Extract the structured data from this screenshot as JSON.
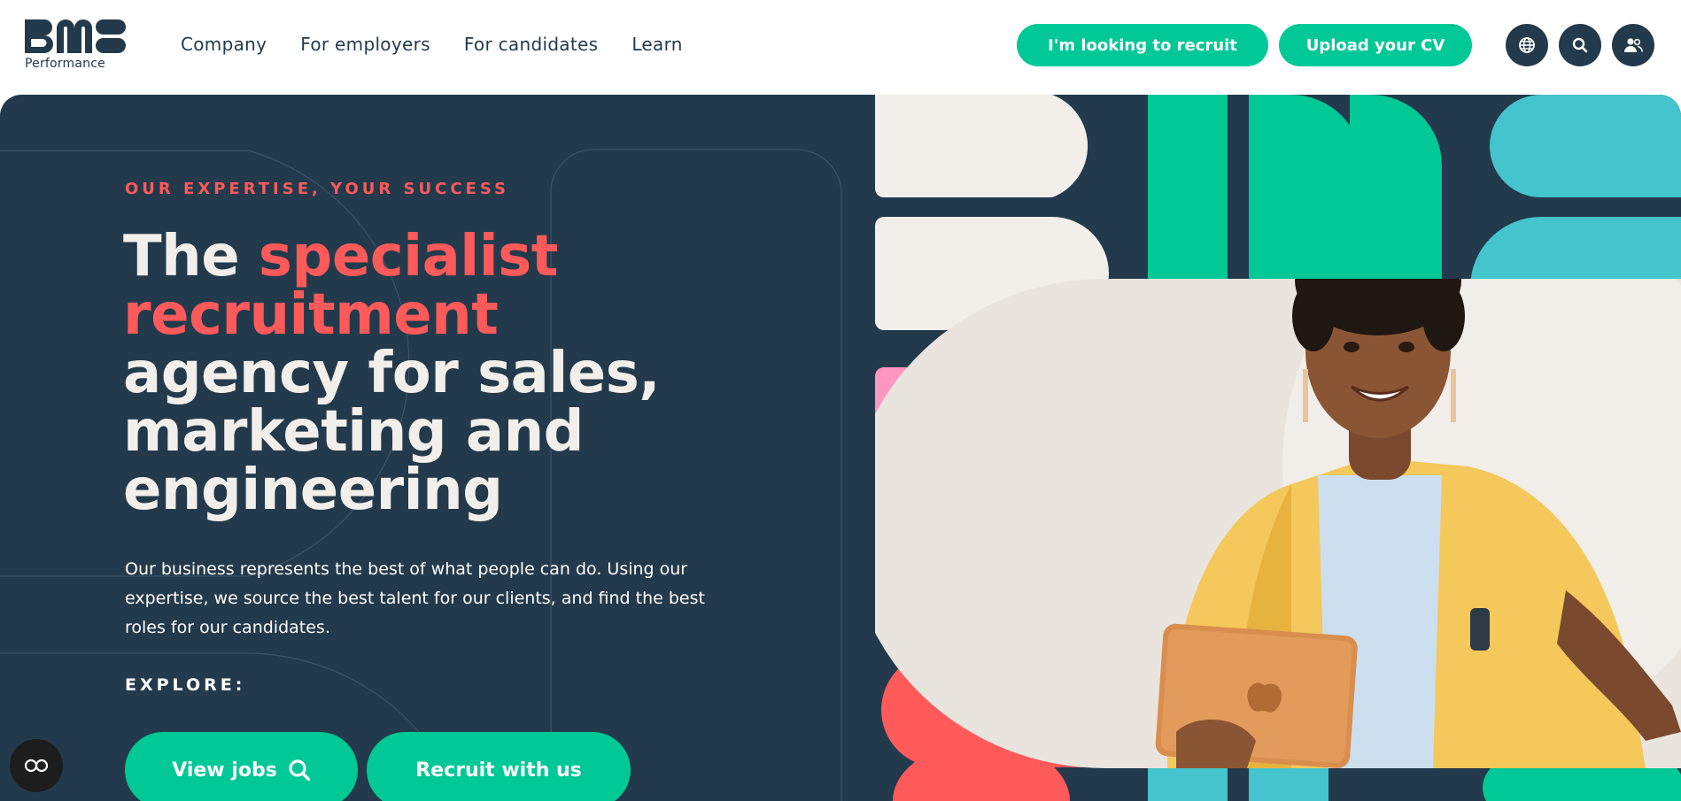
{
  "logo": {
    "subtitle": "Performance"
  },
  "nav": [
    {
      "label": "Company"
    },
    {
      "label": "For employers"
    },
    {
      "label": "For candidates"
    },
    {
      "label": "Learn"
    }
  ],
  "header_ctas": {
    "recruit": "I'm looking to recruit",
    "cv": "Upload your CV"
  },
  "header_icons": [
    "globe-icon",
    "search-icon",
    "user-icon"
  ],
  "hero": {
    "eyebrow": "OUR EXPERTISE, YOUR SUCCESS",
    "headline_1": "The ",
    "headline_highlight": "specialist recruitment",
    "headline_2": " agency for sales, marketing and engineering",
    "intro": "Our business represents the best of what people can do. Using our expertise, we source the best talent for our clients, and find the best roles for our candidates.",
    "explore_label": "EXPLORE:",
    "btn_jobs": "View jobs",
    "btn_recruit": "Recruit with us"
  },
  "colors": {
    "navy": "#223a4c",
    "green": "#00c896",
    "coral": "#ff5a5a",
    "cream": "#f2eee9",
    "pink": "#ff97c0",
    "teal": "#44c4cc",
    "yellow": "#f4c85a"
  },
  "accessibility_button_icon": "accessibility-glasses-icon"
}
